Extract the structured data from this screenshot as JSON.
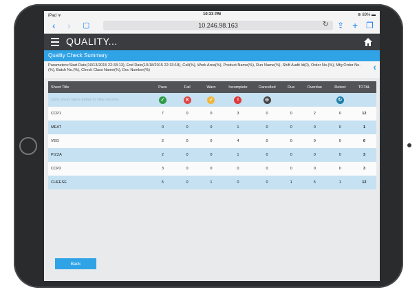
{
  "status": {
    "left": "iPad ᯤ",
    "time": "10:33 PM",
    "battery": "⊕ 89% ▬"
  },
  "browser": {
    "url": "10.246.98.163"
  },
  "app": {
    "title": "QUALITY..."
  },
  "summary": {
    "title": "Quality Check Summary"
  },
  "parameters": "Parameters:Start Date(10/13/2015 22:33:13), End Date(10/18/2015 22:33:18), Cell(%), Work Area(%), Product Name(%), Run Name(%), Shift Audit Id(0), Order No.(%), Mfg Order No.(%), Batch No.(%), Check Class Name(%), Doc Number(%)",
  "table": {
    "headers": [
      "Sheet Title",
      "Pass",
      "Fail",
      "Warn",
      "Incomplete",
      "Cancelled",
      "Due",
      "Overdue",
      "Retest",
      "TOTAL"
    ],
    "hint": "Click sheet name below to view records",
    "rows": [
      [
        "CCP1",
        "7",
        "0",
        "0",
        "3",
        "0",
        "0",
        "2",
        "0",
        "12"
      ],
      [
        "MEAT",
        "0",
        "0",
        "0",
        "1",
        "0",
        "0",
        "0",
        "0",
        "1"
      ],
      [
        "VEG",
        "2",
        "0",
        "0",
        "4",
        "0",
        "0",
        "0",
        "0",
        "6"
      ],
      [
        "PIZZA",
        "2",
        "0",
        "0",
        "1",
        "0",
        "0",
        "0",
        "0",
        "3"
      ],
      [
        "CCP2",
        "3",
        "0",
        "0",
        "0",
        "0",
        "0",
        "0",
        "0",
        "3"
      ],
      [
        "CHEESE",
        "5",
        "0",
        "1",
        "0",
        "0",
        "1",
        "5",
        "1",
        "12"
      ]
    ]
  },
  "icons": {
    "pass": {
      "name": "check-icon",
      "color": "#2e9b46"
    },
    "fail": {
      "name": "x-icon",
      "color": "#e04545"
    },
    "warn": {
      "name": "check-warn-icon",
      "color": "#f2b63a"
    },
    "incomplete": {
      "name": "exclamation-icon",
      "color": "#e03a3a"
    },
    "cancelled": {
      "name": "cancel-icon",
      "color": "#444444"
    },
    "retest": {
      "name": "retest-icon",
      "color": "#1f7fa8"
    }
  },
  "back_label": "Back"
}
